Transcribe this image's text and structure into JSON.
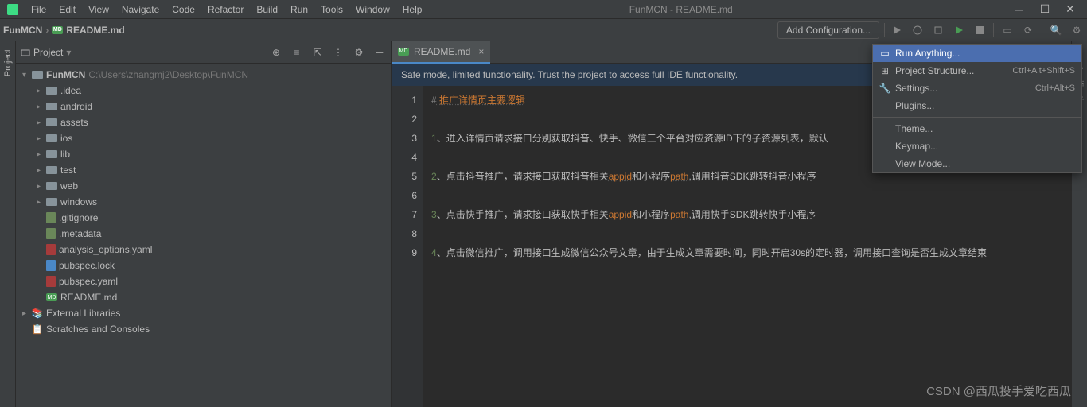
{
  "menu": [
    "File",
    "Edit",
    "View",
    "Navigate",
    "Code",
    "Refactor",
    "Build",
    "Run",
    "Tools",
    "Window",
    "Help"
  ],
  "window_title": "FunMCN - README.md",
  "breadcrumb": {
    "project": "FunMCN",
    "file": "README.md"
  },
  "add_config": "Add Configuration...",
  "project_panel": {
    "title": "Project"
  },
  "tree": {
    "root": "FunMCN",
    "root_path": "C:\\Users\\zhangmj2\\Desktop\\FunMCN",
    "folders": [
      ".idea",
      "android",
      "assets",
      "ios",
      "lib",
      "test",
      "web",
      "windows"
    ],
    "files": [
      {
        "name": ".gitignore",
        "icon": "txt"
      },
      {
        "name": ".metadata",
        "icon": "txt"
      },
      {
        "name": "analysis_options.yaml",
        "icon": "yaml"
      },
      {
        "name": "pubspec.lock",
        "icon": "file"
      },
      {
        "name": "pubspec.yaml",
        "icon": "yaml"
      },
      {
        "name": "README.md",
        "icon": "md"
      }
    ],
    "external": "External Libraries",
    "scratches": "Scratches and Consoles"
  },
  "tab": {
    "name": "README.md"
  },
  "banner": "Safe mode, limited functionality. Trust the project to access full IDE functionality.",
  "code": {
    "lines": [
      1,
      2,
      3,
      4,
      5,
      6,
      7,
      8,
      9
    ],
    "l1_hash": "#",
    "l1_text": " 推广详情页主要逻辑",
    "l3_b": "1",
    "l3_t": "、进入详情页请求接口分别获取抖音、快手、微信三个平台对应资源ID下的子资源列表，默认",
    "l5_b": "2",
    "l5_t1": "、点击抖音推广，请求接口获取抖音相关",
    "l5_k1": "appid",
    "l5_t2": "和小程序",
    "l5_k2": "path",
    "l5_t3": ",调用抖音SDK跳转抖音小程序",
    "l7_b": "3",
    "l7_t1": "、点击快手推广，请求接口获取快手相关",
    "l7_k1": "appid",
    "l7_t2": "和小程序",
    "l7_k2": "path",
    "l7_t3": ",调用快手SDK跳转快手小程序",
    "l9_b": "4",
    "l9_t": "、点击微信推广，调用接口生成微信公众号文章，由于生成文章需要时间，同时开启30s的定时器，调用接口查询是否生成文章结束"
  },
  "popup": [
    {
      "label": "Run Anything...",
      "icon": "run",
      "highlight": true
    },
    {
      "label": "Project Structure...",
      "shortcut": "Ctrl+Alt+Shift+S",
      "icon": "structure"
    },
    {
      "label": "Settings...",
      "shortcut": "Ctrl+Alt+S",
      "icon": "settings"
    },
    {
      "label": "Plugins...",
      "icon": "none"
    },
    {
      "sep": true
    },
    {
      "label": "Theme...",
      "icon": "none"
    },
    {
      "label": "Keymap...",
      "icon": "none"
    },
    {
      "label": "View Mode...",
      "icon": "none"
    }
  ],
  "gutter_left": "Project",
  "gutter_right": "Notifications",
  "watermark": "CSDN @西瓜投手爱吃西瓜"
}
